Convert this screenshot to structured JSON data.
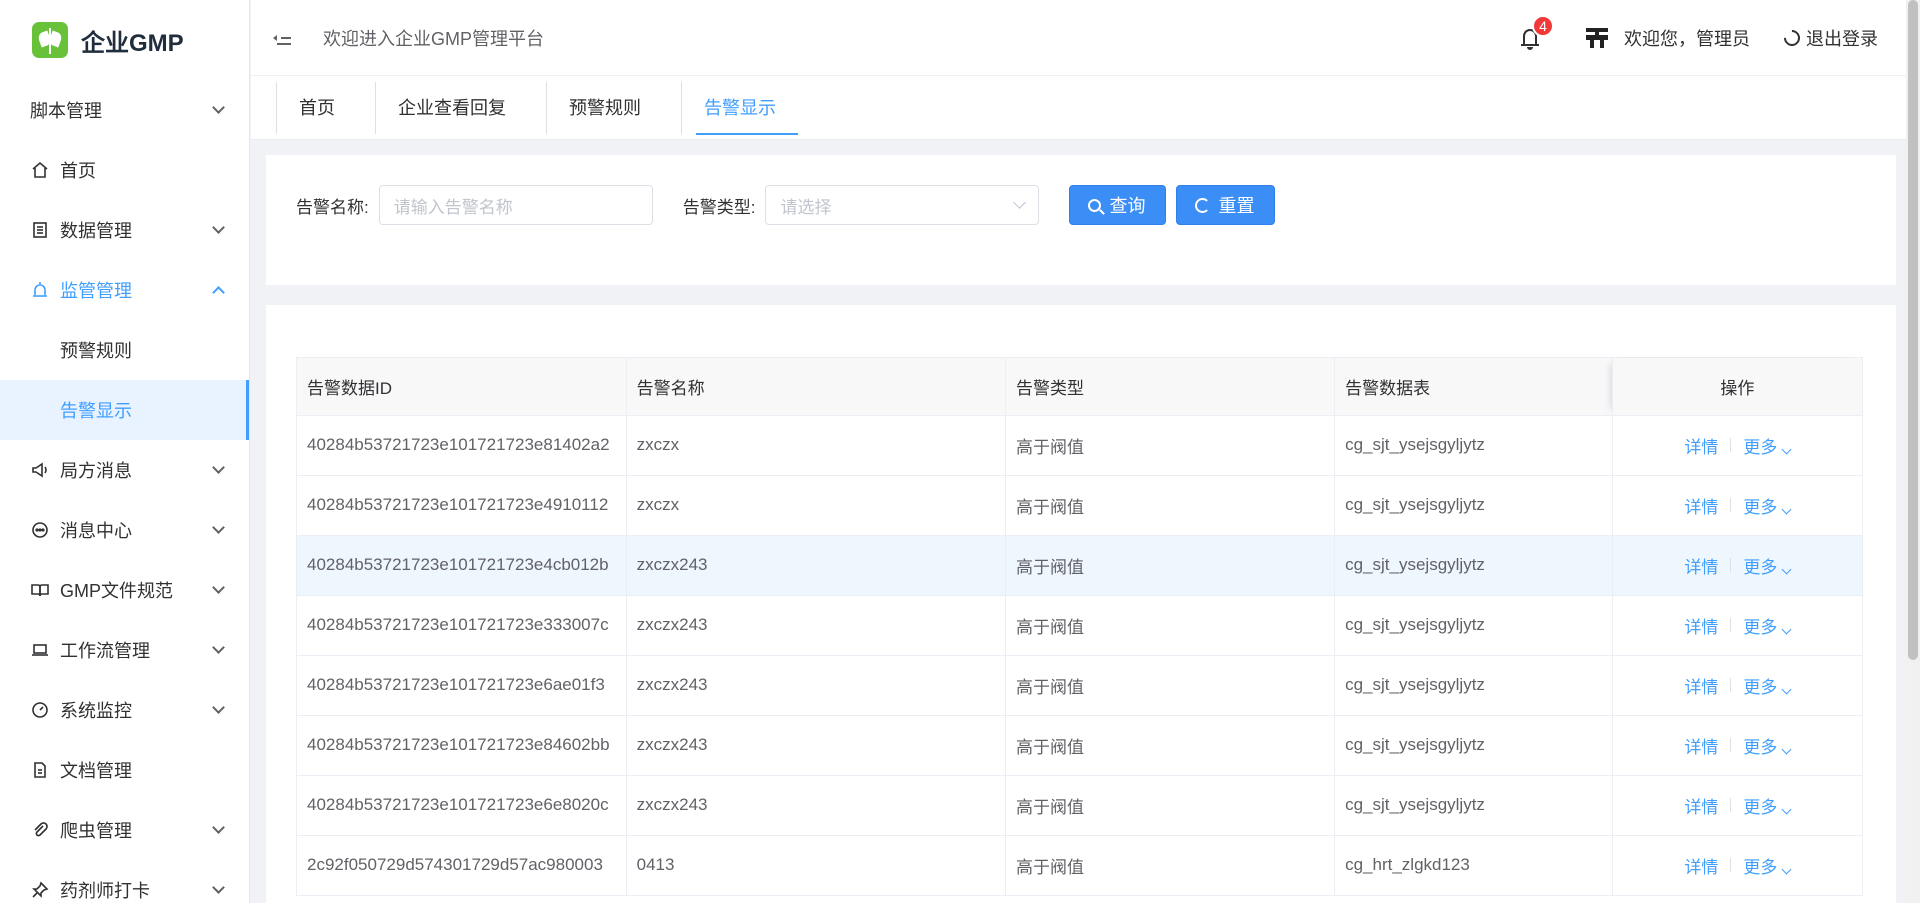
{
  "logo": {
    "text": "企业GMP"
  },
  "sidebar": {
    "items": [
      {
        "label": "脚本管理",
        "icon": "none",
        "expandable": true
      },
      {
        "label": "首页",
        "icon": "home-icon",
        "expandable": false
      },
      {
        "label": "数据管理",
        "icon": "document-list-icon",
        "expandable": true
      },
      {
        "label": "监管管理",
        "icon": "alarm-icon",
        "expandable": true,
        "expanded": true,
        "active": true,
        "children": [
          {
            "label": "预警规则"
          },
          {
            "label": "告警显示",
            "selected": true
          }
        ]
      },
      {
        "label": "局方消息",
        "icon": "megaphone-icon",
        "expandable": true
      },
      {
        "label": "消息中心",
        "icon": "chat-bubble-icon",
        "expandable": true
      },
      {
        "label": "GMP文件规范",
        "icon": "book-icon",
        "expandable": true
      },
      {
        "label": "工作流管理",
        "icon": "laptop-icon",
        "expandable": true
      },
      {
        "label": "系统监控",
        "icon": "gauge-icon",
        "expandable": true
      },
      {
        "label": "文档管理",
        "icon": "file-icon",
        "expandable": false
      },
      {
        "label": "爬虫管理",
        "icon": "paperclip-icon",
        "expandable": true
      },
      {
        "label": "药剂师打卡",
        "icon": "pin-icon",
        "expandable": true
      }
    ]
  },
  "header": {
    "welcome": "欢迎进入企业GMP管理平台",
    "notification_count": "4",
    "user_greeting": "欢迎您，管理员",
    "logout_label": "退出登录"
  },
  "tabs": [
    {
      "label": "首页"
    },
    {
      "label": "企业查看回复"
    },
    {
      "label": "预警规则"
    },
    {
      "label": "告警显示",
      "active": true
    }
  ],
  "search": {
    "name_label": "告警名称:",
    "name_placeholder": "请输入告警名称",
    "type_label": "告警类型:",
    "type_placeholder": "请选择",
    "query_label": "查询",
    "reset_label": "重置"
  },
  "table": {
    "columns": [
      "告警数据ID",
      "告警名称",
      "告警类型",
      "告警数据表",
      "操作"
    ],
    "detail_label": "详情",
    "more_label": "更多",
    "rows": [
      {
        "id": "40284b53721723e101721723e81402a2",
        "name": "zxczx",
        "type": "高于阀值",
        "table": "cg_sjt_ysejsgyljytz"
      },
      {
        "id": "40284b53721723e101721723e4910112",
        "name": "zxczx",
        "type": "高于阀值",
        "table": "cg_sjt_ysejsgyljytz"
      },
      {
        "id": "40284b53721723e101721723e4cb012b",
        "name": "zxczx243",
        "type": "高于阀值",
        "table": "cg_sjt_ysejsgyljytz",
        "highlight": true
      },
      {
        "id": "40284b53721723e101721723e333007c",
        "name": "zxczx243",
        "type": "高于阀值",
        "table": "cg_sjt_ysejsgyljytz"
      },
      {
        "id": "40284b53721723e101721723e6ae01f3",
        "name": "zxczx243",
        "type": "高于阀值",
        "table": "cg_sjt_ysejsgyljytz"
      },
      {
        "id": "40284b53721723e101721723e84602bb",
        "name": "zxczx243",
        "type": "高于阀值",
        "table": "cg_sjt_ysejsgyljytz"
      },
      {
        "id": "40284b53721723e101721723e6e8020c",
        "name": "zxczx243",
        "type": "高于阀值",
        "table": "cg_sjt_ysejsgyljytz"
      },
      {
        "id": "2c92f050729d574301729d57ac980003",
        "name": "0413",
        "type": "高于阀值",
        "table": "cg_hrt_zlgkd123"
      }
    ]
  },
  "colors": {
    "accent": "#409eff",
    "button": "#3a8ef6",
    "badge": "#f23838",
    "logo": "#67c23a",
    "row_highlight": "#eef6fe"
  }
}
